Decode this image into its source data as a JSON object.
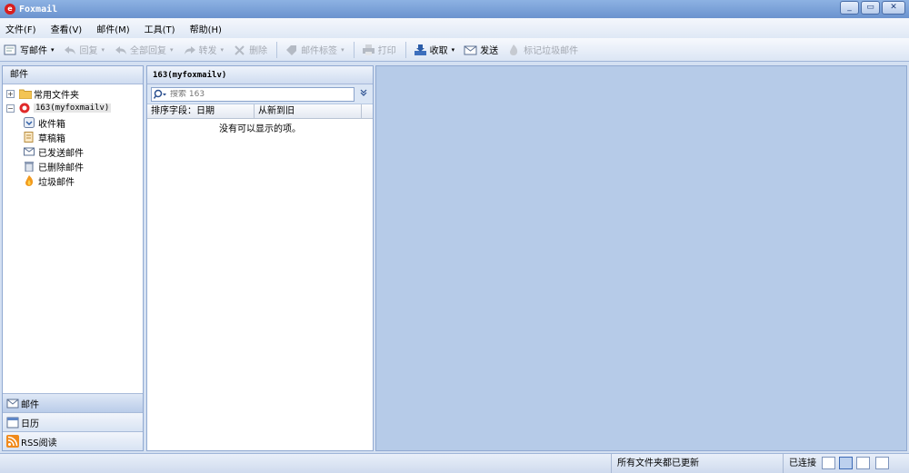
{
  "window": {
    "title": "Foxmail",
    "controls": [
      "_",
      "▭",
      "✕"
    ]
  },
  "menu": [
    {
      "label": "文件(F)"
    },
    {
      "label": "查看(V)"
    },
    {
      "label": "邮件(M)"
    },
    {
      "label": "工具(T)"
    },
    {
      "label": "帮助(H)"
    }
  ],
  "toolbar": {
    "compose": "写邮件",
    "reply": "回复",
    "reply_all": "全部回复",
    "forward": "转发",
    "delete": "删除",
    "tag": "邮件标签",
    "print": "打印",
    "receive": "收取",
    "send": "发送",
    "spam": "标记垃圾邮件",
    "caret": "▾"
  },
  "left_panel": {
    "header": "邮件",
    "tree": {
      "common": "常用文件夹",
      "account": "163(myfoxmailv)",
      "expand_plus": "+",
      "expand_minus": "−",
      "folders": [
        "收件箱",
        "草稿箱",
        "已发送邮件",
        "已删除邮件",
        "垃圾邮件"
      ]
    },
    "nav": [
      "邮件",
      "日历",
      "RSS阅读"
    ]
  },
  "mid_panel": {
    "header": "163(myfoxmailv)",
    "search_placeholder": "搜索 163",
    "col_sort": "排序字段：日期",
    "col_order": "从新到旧",
    "empty": "没有可以显示的项。"
  },
  "status": {
    "message": "所有文件夹都已更新",
    "connection": "已连接"
  }
}
